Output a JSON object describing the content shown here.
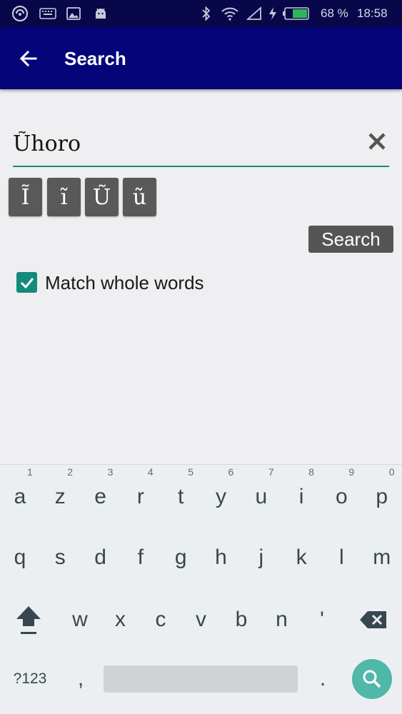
{
  "status_bar": {
    "battery_percent": "68 %",
    "time": "18:58",
    "icons": [
      "app-swirl-icon",
      "keyboard-icon",
      "image-icon",
      "android-icon",
      "bluetooth-icon",
      "wifi-icon",
      "signal-icon",
      "charging-icon",
      "battery-icon"
    ]
  },
  "app_bar": {
    "title": "Search",
    "back_icon": "arrow-left-icon"
  },
  "search": {
    "value": "Ũhoro",
    "clear_icon": "close-icon"
  },
  "special_chars": [
    "Ĩ",
    "ĩ",
    "Ũ",
    "ũ"
  ],
  "search_button": "Search",
  "match_whole_words": {
    "label": "Match whole words",
    "checked": true
  },
  "keyboard": {
    "row1": [
      "a",
      "z",
      "e",
      "r",
      "t",
      "y",
      "u",
      "i",
      "o",
      "p"
    ],
    "row1_hints": [
      "1",
      "2",
      "3",
      "4",
      "5",
      "6",
      "7",
      "8",
      "9",
      "0"
    ],
    "row2": [
      "q",
      "s",
      "d",
      "f",
      "g",
      "h",
      "j",
      "k",
      "l",
      "m"
    ],
    "row3": [
      "w",
      "x",
      "c",
      "v",
      "b",
      "n",
      "'"
    ],
    "symbols_key": "?123",
    "comma_key": ",",
    "period_key": ".",
    "shift_icon": "shift-icon",
    "backspace_icon": "backspace-icon",
    "enter_icon": "search-icon"
  },
  "colors": {
    "status_bar": "#07074a",
    "app_bar": "#05057a",
    "accent": "#128a7c",
    "button": "#595959",
    "keyboard_bg": "#eceff1",
    "enter_key": "#4fb8a8"
  }
}
